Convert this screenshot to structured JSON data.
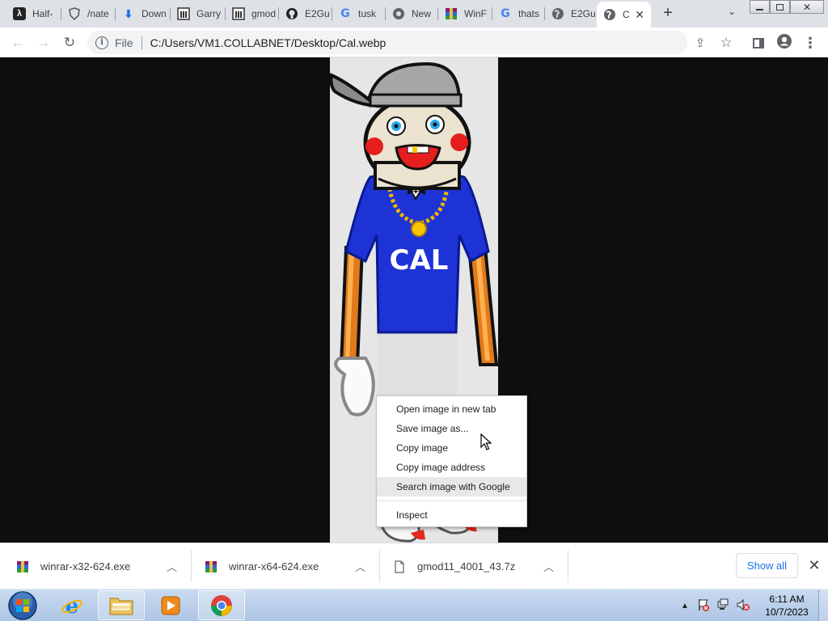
{
  "tabs": [
    {
      "title": "Half-",
      "icon": "half-life-icon"
    },
    {
      "title": "/nate",
      "icon": "shield-icon"
    },
    {
      "title": "Down",
      "icon": "download-icon"
    },
    {
      "title": "Garry",
      "icon": "gmod-wiki-icon"
    },
    {
      "title": "gmod",
      "icon": "gmod-wiki-icon"
    },
    {
      "title": "E2Gu",
      "icon": "github-icon"
    },
    {
      "title": "tusk",
      "icon": "google-icon"
    },
    {
      "title": "New",
      "icon": "chrome-icon"
    },
    {
      "title": "WinF",
      "icon": "winrar-icon"
    },
    {
      "title": "thats",
      "icon": "google-icon"
    },
    {
      "title": "E2Gu",
      "icon": "globe-icon"
    },
    {
      "title": "C",
      "icon": "globe-icon",
      "active": true
    }
  ],
  "toolbar": {
    "scheme": "File",
    "url": "C:/Users/VM1.COLLABNET/Desktop/Cal.webp"
  },
  "image": {
    "shirt_text": "CAL"
  },
  "context_menu": {
    "items": [
      "Open image in new tab",
      "Save image as...",
      "Copy image",
      "Copy image address",
      "Search image with Google",
      "Inspect"
    ],
    "hovered_index": 4
  },
  "downloads": {
    "items": [
      {
        "name": "winrar-x32-624.exe",
        "icon": "winrar-icon"
      },
      {
        "name": "winrar-x64-624.exe",
        "icon": "winrar-icon"
      },
      {
        "name": "gmod11_4001_43.7z",
        "icon": "file-icon"
      }
    ],
    "show_all": "Show all"
  },
  "taskbar": {
    "time": "6:11 AM",
    "date": "10/7/2023"
  },
  "colors": {
    "tabstrip": "#dee1e6",
    "shirt": "#1d33d6",
    "link": "#1a73e8"
  }
}
